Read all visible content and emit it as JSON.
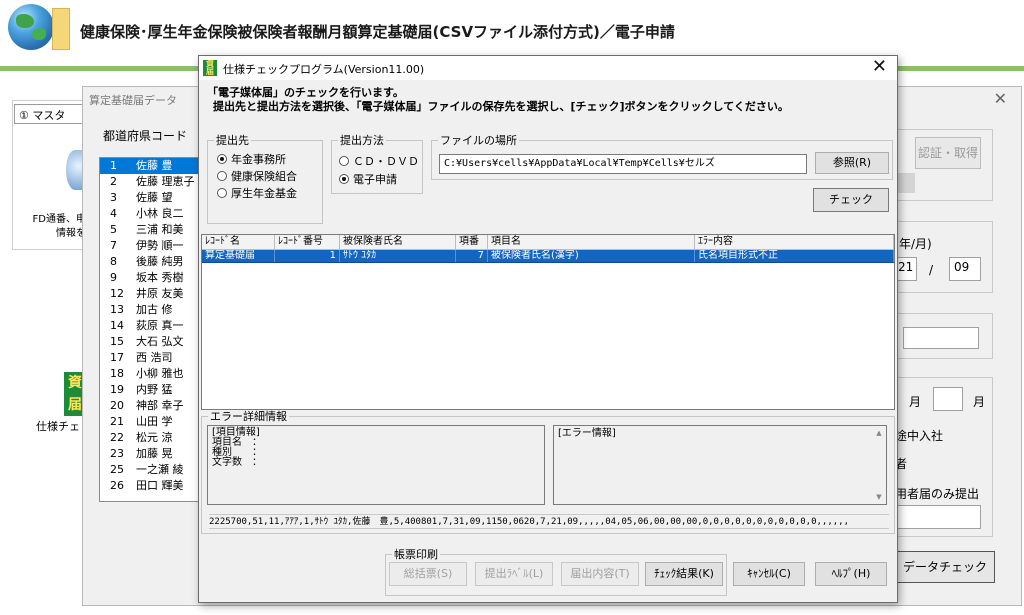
{
  "app": {
    "title": "健康保険･厚生年金保険被保険者報酬月額算定基礎届(CSVファイル添付方式)／電子申請"
  },
  "background": {
    "master_tab": "① マスタ",
    "fd_text": [
      "FD通番、申",
      "情報を"
    ],
    "spec_label": "仕様チェッ",
    "spec_icon_glyph": "資届"
  },
  "mid_window": {
    "title": "算定基礎届データ",
    "close": "✕",
    "pref_label": "都道府県コード",
    "rows": [
      {
        "no": "1",
        "name": "佐藤 豊"
      },
      {
        "no": "2",
        "name": "佐藤 理恵子"
      },
      {
        "no": "3",
        "name": "佐藤 望"
      },
      {
        "no": "4",
        "name": "小林 良二"
      },
      {
        "no": "5",
        "name": "三浦 和美"
      },
      {
        "no": "7",
        "name": "伊勢 順一"
      },
      {
        "no": "8",
        "name": "後藤 純男"
      },
      {
        "no": "9",
        "name": "坂本 秀樹"
      },
      {
        "no": "12",
        "name": "井原 友美"
      },
      {
        "no": "13",
        "name": "加古 修"
      },
      {
        "no": "14",
        "name": "荻原 真一"
      },
      {
        "no": "15",
        "name": "大石 弘文"
      },
      {
        "no": "17",
        "name": "西 浩司"
      },
      {
        "no": "18",
        "name": "小柳 雅也"
      },
      {
        "no": "19",
        "name": "内野 猛"
      },
      {
        "no": "20",
        "name": "神部 幸子"
      },
      {
        "no": "21",
        "name": "山田 学"
      },
      {
        "no": "22",
        "name": "松元 涼"
      },
      {
        "no": "23",
        "name": "加藤 晃"
      },
      {
        "no": "25",
        "name": "一之瀬 綾"
      },
      {
        "no": "26",
        "name": "田口 輝美"
      }
    ],
    "auth_button": "認証・取得",
    "year_month_label": "年/月)",
    "date_day": "21",
    "date_slash": "/",
    "date_month": "09",
    "month_label_1": "月",
    "month_label_2": "月",
    "mid_join": "途中入社",
    "suffix_text": "者",
    "only_submit": "用者届のみ提出",
    "data_check_button": "データチェック"
  },
  "dialog": {
    "title": "仕様チェックプログラム(Version11.00)",
    "close": "✕",
    "intro_line1": "「電子媒体届」のチェックを行います。",
    "intro_line2": "提出先と提出方法を選択後、「電子媒体届」ファイルの保存先を選択し、[チェック]ボタンをクリックしてください。",
    "submit_to": {
      "legend": "提出先",
      "options": [
        {
          "label": "年金事務所",
          "checked": true
        },
        {
          "label": "健康保険組合",
          "checked": false
        },
        {
          "label": "厚生年金基金",
          "checked": false
        }
      ]
    },
    "method": {
      "legend": "提出方法",
      "options": [
        {
          "label": "ＣＤ・ＤＶＤ",
          "checked": false
        },
        {
          "label": "電子申請",
          "checked": true
        }
      ]
    },
    "file_location": {
      "legend": "ファイルの場所",
      "path": "C:¥Users¥cells¥AppData¥Local¥Temp¥Cells¥セルズ",
      "browse_button": "参照(R)"
    },
    "check_button": "チェック",
    "grid": {
      "headers": [
        "ﾚｺｰﾄﾞ名",
        "ﾚｺｰﾄﾞ番号",
        "被保険者氏名",
        "項番",
        "項目名",
        "ｴﾗｰ内容"
      ],
      "rows": [
        [
          "算定基礎届",
          "1",
          "ｻﾄｳ ﾕﾀｶ",
          "7",
          "被保険者氏名(漢字)",
          "氏名項目形式不正"
        ]
      ]
    },
    "error_detail": {
      "legend": "エラー詳細情報",
      "left_title": "[項目情報]",
      "left_lines": [
        "項目名　：",
        "種別　　：",
        "文字数　："
      ],
      "right_title": "[エラー情報]",
      "csv_line": "2225700,51,11,ｱｱｱ,1,ｻﾄｳ ﾕﾀｶ,佐藤　豊,5,400801,7,31,09,1150,0620,7,21,09,,,,,04,05,06,00,00,00,0,0,0,0,0,0,0,0,0,0,0,,,,,,"
    },
    "print": {
      "legend": "帳票印刷",
      "buttons": [
        {
          "label": "総括票(S)",
          "enabled": false
        },
        {
          "label": "提出ﾗﾍﾞﾙ(L)",
          "enabled": false
        },
        {
          "label": "届出内容(T)",
          "enabled": false
        },
        {
          "label": "ﾁｪｯｸ結果(K)",
          "enabled": true
        }
      ]
    },
    "cancel_button": "ｷｬﾝｾﾙ(C)",
    "help_button": "ﾍﾙﾌﾟ(H)"
  },
  "colors": {
    "selection": "#1565c0",
    "list_selection": "#0078d7",
    "header_green": "#8bbf6c"
  }
}
